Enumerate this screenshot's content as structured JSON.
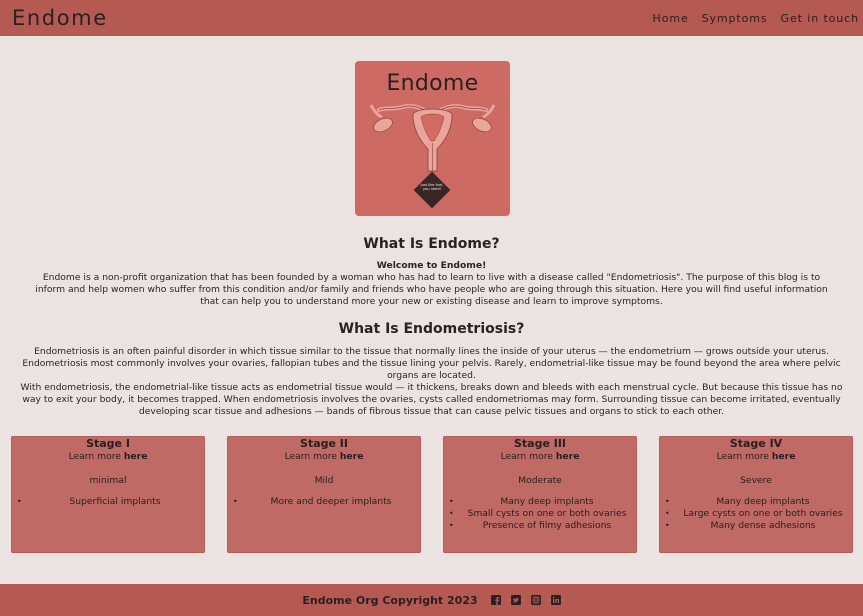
{
  "header": {
    "brand": "Endome",
    "nav": [
      {
        "label": "Home"
      },
      {
        "label": "Symptoms"
      },
      {
        "label": "Get in touch"
      }
    ]
  },
  "logo": {
    "title": "Endome",
    "badge_text": "Just like fuel, you need!"
  },
  "about": {
    "heading": "What Is Endome?",
    "welcome": "Welcome to Endome!",
    "paragraph": "Endome is a non-profit organization that has been founded by a woman who has had to learn to live with a disease called \"Endometriosis\". The purpose of this blog is to inform and help women who suffer from this condition and/or family and friends who have people who are going through this situation. Here you will find useful information that can help you to understand more your new or existing disease and learn to improve symptoms."
  },
  "endometriosis": {
    "heading": "What Is Endometriosis?",
    "paragraph1": "Endometriosis is an often painful disorder in which tissue similar to the tissue that normally lines the inside of your uterus — the endometrium — grows outside your uterus. Endometriosis most commonly involves your ovaries, fallopian tubes and the tissue lining your pelvis. Rarely, endometrial-like tissue may be found beyond the area where pelvic organs are located.",
    "paragraph2": "With endometriosis, the endometrial-like tissue acts as endometrial tissue would — it thickens, breaks down and bleeds with each menstrual cycle. But because this tissue has no way to exit your body, it becomes trapped. When endometriosis involves the ovaries, cysts called endometriomas may form. Surrounding tissue can become irritated, eventually developing scar tissue and adhesions — bands of fibrous tissue that can cause pelvic tissues and organs to stick to each other."
  },
  "stages": [
    {
      "title": "Stage I",
      "learn_prefix": "Learn more",
      "learn_link": "here",
      "level": "minimal",
      "items": [
        "Superficial implants"
      ]
    },
    {
      "title": "Stage II",
      "learn_prefix": "Learn more",
      "learn_link": "here",
      "level": "Mild",
      "items": [
        "More and deeper implants"
      ]
    },
    {
      "title": "Stage III",
      "learn_prefix": "Learn more",
      "learn_link": "here",
      "level": "Moderate",
      "items": [
        "Many deep implants",
        "Small cysts on one or both ovaries",
        "Presence of filmy adhesions"
      ]
    },
    {
      "title": "Stage IV",
      "learn_prefix": "Learn more",
      "learn_link": "here",
      "level": "Severe",
      "items": [
        "Many deep implants",
        "Large cysts on one or both ovaries",
        "Many dense adhesions"
      ]
    }
  ],
  "footer": {
    "copyright": "Endome Org Copyright 2023",
    "social_icons": [
      "facebook-icon",
      "twitter-icon",
      "instagram-icon",
      "linkedin-icon"
    ]
  },
  "colors": {
    "header_bg": "#b45a53",
    "page_bg": "#ebe2e2",
    "logo_bg": "#cc6a63",
    "card_bg": "#bf6a65"
  }
}
